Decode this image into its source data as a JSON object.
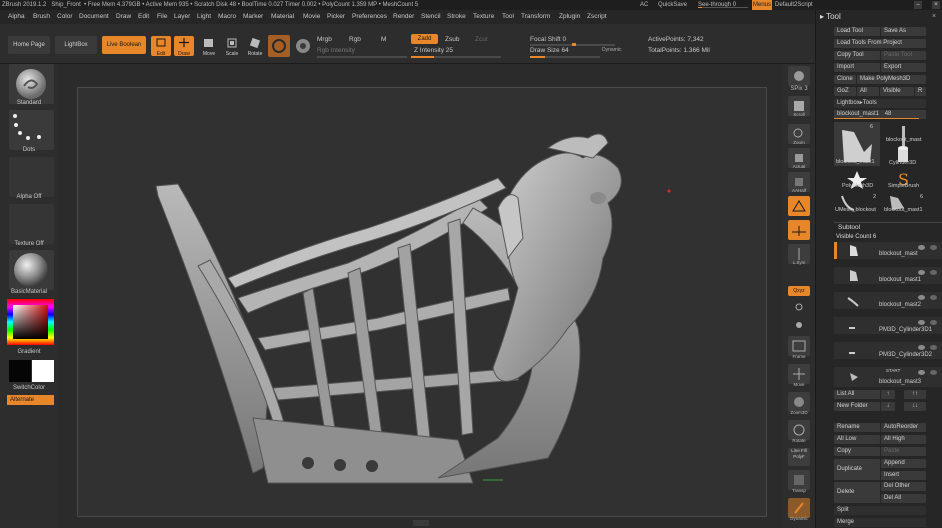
{
  "titlebar": {
    "app": "ZBrush 2019.1.2",
    "file": "Ship_Front",
    "stats": "• Free Mem 4.379GB • Active Mem 935 • Scratch Disk 48 • BoolTime 0.027 Timer 0.002 • PolyCount 1.359 MP • MeshCount 5",
    "ac": "AC",
    "quicksave": "QuickSave",
    "seethrough": "See-through 0",
    "menus": "Menus",
    "script": "Default2Script"
  },
  "menubar": [
    "Alpha",
    "Brush",
    "Color",
    "Document",
    "Draw",
    "Edit",
    "File",
    "Layer",
    "Light",
    "Macro",
    "Marker",
    "Material",
    "Movie",
    "Picker",
    "Preferences",
    "Render",
    "Stencil",
    "Stroke",
    "Texture",
    "Tool",
    "Transform",
    "Zplugin",
    "Zscript"
  ],
  "toolbar": {
    "home": "Home Page",
    "lightbox": "LightBox",
    "liveboolean": "Live Boolean",
    "edit": "Edit",
    "draw": "Draw",
    "move": "Move",
    "scale": "Scale",
    "rotate": "Rotate",
    "mrgb": "Mrgb",
    "rgb": "Rgb",
    "m": "M",
    "rgb_intensity": "Rgb Intensity",
    "zadd": "Zadd",
    "zsub": "Zsub",
    "zcut": "Zcut",
    "z_intensity_label": "Z Intensity",
    "z_intensity_value": "25",
    "z_intensity": 25,
    "focal_label": "Focal Shift",
    "focal_value": "0",
    "drawsize_label": "Draw Size",
    "drawsize_value": "64",
    "dynamic": "Dynamic",
    "active_points": "ActivePoints: 7,342",
    "total_points": "TotalPoints: 1.366 Mil"
  },
  "leftshelf": {
    "standard": "Standard",
    "dots": "Dots",
    "alpha_off": "Alpha Off",
    "texture_off": "Texture Off",
    "material": "BasicMaterial",
    "gradient": "Gradient",
    "switchcolor": "SwitchColor",
    "alternate": "Alternate"
  },
  "rightshelf": [
    "BPR",
    "SPix 3",
    "Scroll",
    "Zoom",
    "Actual",
    "AAHalf",
    "Persp",
    "Floor",
    "L.Sym",
    "",
    "Qxyz",
    "",
    "",
    "Frame",
    "Move",
    "Zoom3D",
    "Rotate",
    "Line Fill PolyF",
    "Transp",
    "",
    "Dynamic",
    "Solo"
  ],
  "spix": "SPix 3",
  "toolpanel": {
    "title": "Tool",
    "buttons": {
      "load_tool": "Load Tool",
      "save_as": "Save As",
      "load_from_project": "Load Tools From Project",
      "copy_tool": "Copy Tool",
      "paste_tool": "Paste Tool",
      "import": "Import",
      "export": "Export",
      "clone": "Clone",
      "make_polymesh": "Make PolyMesh3D",
      "goz": "GoZ",
      "all": "All",
      "visible": "Visible",
      "r": "R",
      "lightbox_tools": "Lightbox▸Tools",
      "current_tool": "blockout_mast1",
      "current_count": "48"
    },
    "thumbs": [
      {
        "name": "blockout_mast1",
        "count": "6"
      },
      {
        "name": "blockout_mast"
      },
      {
        "name": "Cylinder3D"
      },
      {
        "name": "PolyMesh3D"
      },
      {
        "name": "SimpleBrush"
      },
      {
        "name": "UMesh_blockout",
        "count": "2"
      },
      {
        "name": "blockout_mast1",
        "count": "6"
      }
    ],
    "subtool": {
      "title": "Subtool",
      "visible_count": "Visible Count 6",
      "items": [
        "blockout_mast",
        "blockout_mast1",
        "blockout_mast2",
        "PM3D_Cylinder3D1",
        "PM3D_Cylinder3D2",
        "blockout_mast3"
      ],
      "start_label": "START"
    },
    "actions": {
      "list_all": "List All",
      "new_folder": "New Folder",
      "rename": "Rename",
      "autoreorder": "AutoReorder",
      "all_low": "All Low",
      "all_high": "All High",
      "copy": "Copy",
      "paste": "Paste",
      "append": "Append",
      "duplicate": "Duplicate",
      "insert": "Insert",
      "delete": "Delete",
      "del_other": "Del Other",
      "del_all": "Del All",
      "split": "Split",
      "merge": "Merge"
    }
  },
  "colors": {
    "accent": "#e8862a",
    "bg": "#2b2b2b",
    "panel": "#262626"
  }
}
